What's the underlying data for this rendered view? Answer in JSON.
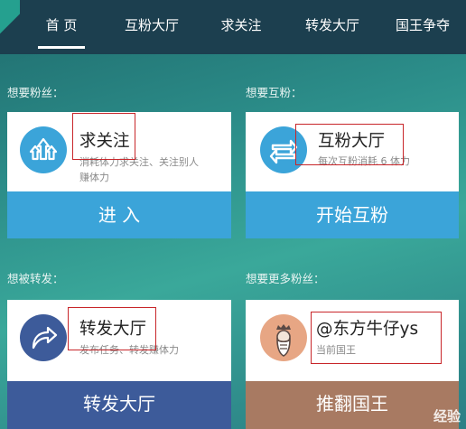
{
  "nav": {
    "items": [
      {
        "label": "首 页",
        "active": true
      },
      {
        "label": "互粉大厅",
        "active": false
      },
      {
        "label": "求关注",
        "active": false
      },
      {
        "label": "转发大厅",
        "active": false
      },
      {
        "label": "国王争夺",
        "active": false
      }
    ]
  },
  "sections": {
    "want_fans": "想要粉丝：",
    "want_mutual": "想要互粉：",
    "want_repost": "想被转发：",
    "want_more_fans": "想要更多粉丝："
  },
  "cards": {
    "follow": {
      "title": "求关注",
      "desc_line1": "消耗体力求关注、关注别人",
      "desc_line2": "赚体力",
      "button": "进 入",
      "icon": "up-arrows-icon",
      "button_color": "#3ba4d9"
    },
    "mutual": {
      "title": "互粉大厅",
      "desc_line1": "每次互粉消耗 6 体力",
      "button": "开始互粉",
      "icon": "swap-arrows-icon",
      "button_color": "#3ba4d9"
    },
    "repost": {
      "title": "转发大厅",
      "desc_line1": "发布任务、转发赚体力",
      "button": "转发大厅",
      "icon": "share-arrow-icon",
      "button_color": "#3d5b9a"
    },
    "king": {
      "title": "@东方牛仔ys",
      "desc_line1": "当前国王",
      "button": "推翻国王",
      "icon": "king-avatar-icon",
      "button_color": "#a87a62"
    }
  },
  "watermark": "经验"
}
